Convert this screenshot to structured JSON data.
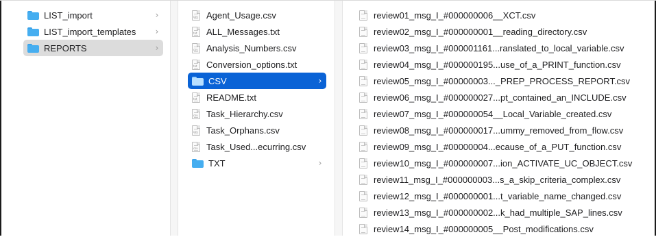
{
  "columns": {
    "folders": [
      {
        "label": "LIST_import",
        "state": "normal"
      },
      {
        "label": "LIST_import_templates",
        "state": "normal"
      },
      {
        "label": "REPORTS",
        "state": "selected-gray"
      }
    ],
    "reports": [
      {
        "label": "Agent_Usage.csv",
        "kind": "file",
        "tag": "csv"
      },
      {
        "label": "ALL_Messages.txt",
        "kind": "file",
        "tag": "txt"
      },
      {
        "label": "Analysis_Numbers.csv",
        "kind": "file",
        "tag": "csv"
      },
      {
        "label": "Conversion_options.txt",
        "kind": "file",
        "tag": "txt"
      },
      {
        "label": "CSV",
        "kind": "folder",
        "state": "selected-blue"
      },
      {
        "label": "README.txt",
        "kind": "file",
        "tag": "txt"
      },
      {
        "label": "Task_Hierarchy.csv",
        "kind": "file",
        "tag": "csv"
      },
      {
        "label": "Task_Orphans.csv",
        "kind": "file",
        "tag": "csv"
      },
      {
        "label": "Task_Used...ecurring.csv",
        "kind": "file",
        "tag": "csv"
      },
      {
        "label": "TXT",
        "kind": "folder",
        "state": "normal"
      }
    ],
    "csv_files": [
      "review01_msg_I_#000000006__XCT.csv",
      "review02_msg_I_#000000001__reading_directory.csv",
      "review03_msg_I_#000001161...ranslated_to_local_variable.csv",
      "review04_msg_I_#000000195...use_of_a_PRINT_function.csv",
      "review05_msg_I_#00000003..._PREP_PROCESS_REPORT.csv",
      "review06_msg_I_#000000027...pt_contained_an_INCLUDE.csv",
      "review07_msg_I_#000000054__Local_Variable_created.csv",
      "review08_msg_I_#000000017...ummy_removed_from_flow.csv",
      "review09_msg_I_#00000004...ecause_of_a_PUT_function.csv",
      "review10_msg_I_#000000007...ion_ACTIVATE_UC_OBJECT.csv",
      "review11_msg_I_#000000003...s_a_skip_criteria_complex.csv",
      "review12_msg_I_#000000001...t_variable_name_changed.csv",
      "review13_msg_I_#000000002...k_had_multiple_SAP_lines.csv",
      "review14_msg_I_#000000005__Post_modifications.csv"
    ]
  },
  "icons": {
    "folder": "folder-icon",
    "file": "document-icon",
    "chevron": "chevron-right-icon"
  },
  "colors": {
    "selection_blue": "#0a63d6",
    "selection_gray": "#dcdcdc",
    "folder_blue": "#46aef0"
  }
}
